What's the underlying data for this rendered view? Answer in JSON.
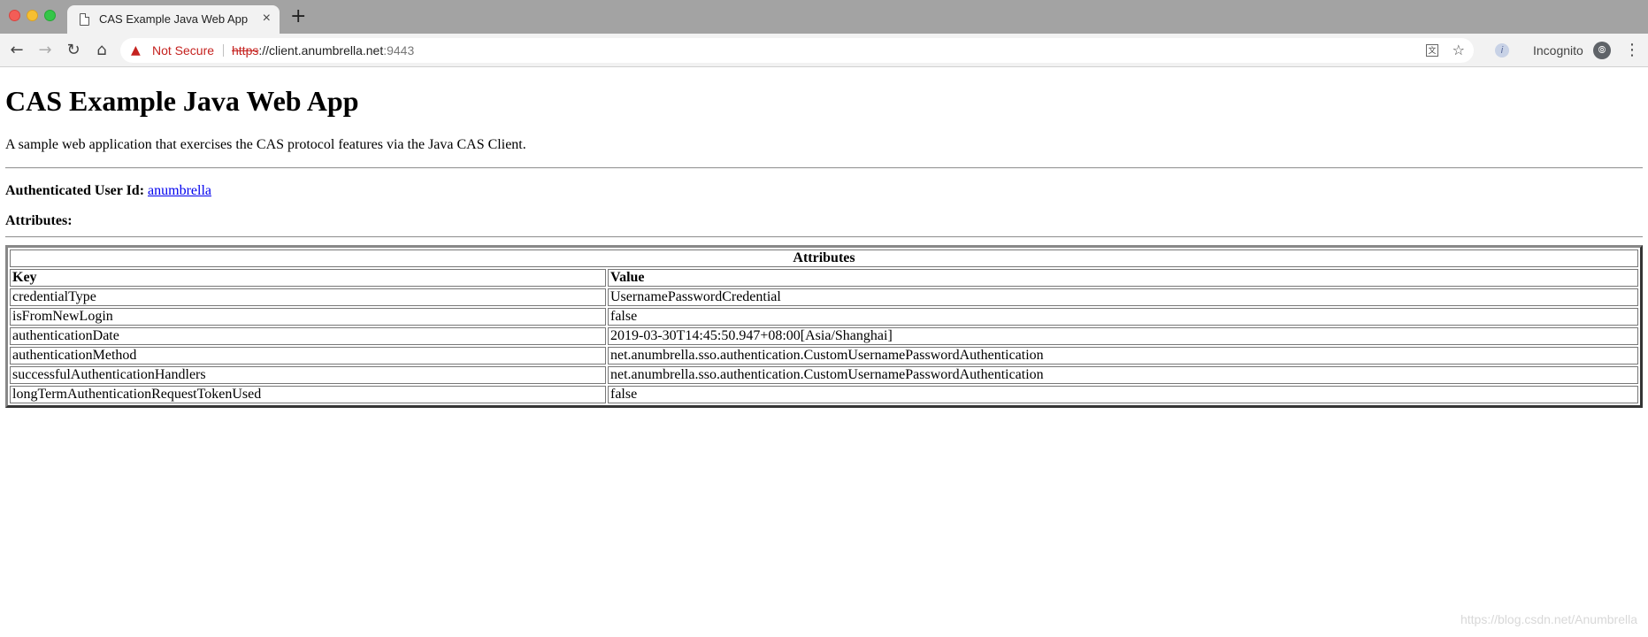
{
  "browser": {
    "tab": {
      "title": "CAS Example Java Web App",
      "close": "×"
    },
    "new_tab": "+",
    "nav": {
      "back": "←",
      "forward": "→",
      "reload": "↻",
      "home": "⌂"
    },
    "omnibox": {
      "warning_icon": "▲",
      "security_label": "Not Secure",
      "url_protocol": "https",
      "url_sep": "://",
      "url_host": "client.anumbrella.net",
      "url_port": ":9443"
    },
    "translate_icon": "文",
    "star_icon": "☆",
    "extension_icon": "i",
    "incognito_label": "Incognito",
    "incognito_icon": "⦾",
    "menu_icon": "⋮",
    "icons": [
      "warning-icon",
      "translate-icon",
      "star-icon",
      "extension-icon",
      "incognito-icon",
      "menu-icon",
      "document-icon",
      "close-icon",
      "plus-icon",
      "back-icon",
      "forward-icon",
      "reload-icon",
      "home-icon"
    ]
  },
  "page": {
    "title": "CAS Example Java Web App",
    "description": "A sample web application that exercises the CAS protocol features via the Java CAS Client.",
    "user_label": "Authenticated User Id:",
    "user_id": "anumbrella",
    "attributes_label": "Attributes:",
    "table": {
      "caption": "Attributes",
      "headers": [
        "Key",
        "Value"
      ],
      "rows": [
        [
          "credentialType",
          "UsernamePasswordCredential"
        ],
        [
          "isFromNewLogin",
          "false"
        ],
        [
          "authenticationDate",
          "2019-03-30T14:45:50.947+08:00[Asia/Shanghai]"
        ],
        [
          "authenticationMethod",
          "net.anumbrella.sso.authentication.CustomUsernamePasswordAuthentication"
        ],
        [
          "successfulAuthenticationHandlers",
          "net.anumbrella.sso.authentication.CustomUsernamePasswordAuthentication"
        ],
        [
          "longTermAuthenticationRequestTokenUsed",
          "false"
        ]
      ]
    }
  },
  "watermark": "https://blog.csdn.net/Anumbrella",
  "colors": {
    "tabbar_bg": "#a3a3a3",
    "toolbar_bg": "#f2f2f2",
    "not_secure": "#c5221f",
    "link": "#0000ee"
  }
}
